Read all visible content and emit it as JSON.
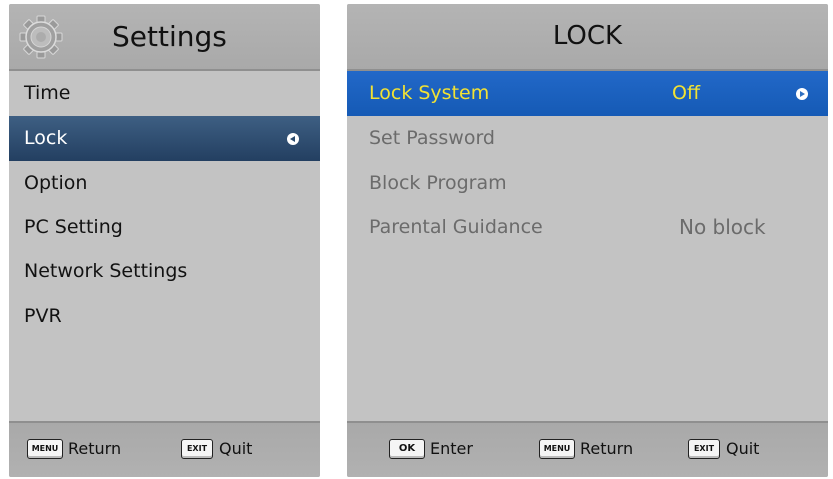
{
  "settings": {
    "title": "Settings",
    "icon": "gear-icon",
    "items": [
      {
        "label": "Time"
      },
      {
        "label": "Lock",
        "selected": true
      },
      {
        "label": "Option"
      },
      {
        "label": "PC Setting"
      },
      {
        "label": "Network Settings"
      },
      {
        "label": "PVR"
      }
    ],
    "footer": [
      {
        "key": "MENU",
        "label": "Return"
      },
      {
        "key": "EXIT",
        "label": "Quit"
      }
    ]
  },
  "lock": {
    "title": "LOCK",
    "items": [
      {
        "label": "Lock System",
        "value": "Off",
        "selected": true
      },
      {
        "label": "Set Password",
        "value": ""
      },
      {
        "label": "Block Program",
        "value": ""
      },
      {
        "label": "Parental Guidance",
        "value": "No block"
      }
    ],
    "footer": [
      {
        "key": "OK",
        "label": "Enter"
      },
      {
        "key": "MENU",
        "label": "Return"
      },
      {
        "key": "EXIT",
        "label": "Quit"
      }
    ]
  },
  "colors": {
    "panel_bg": "#c3c3c3",
    "left_selection": "#2d4b6f",
    "right_selection": "#1c62c0",
    "right_selected_text": "#f2e233",
    "disabled_text": "#6b6b6b"
  }
}
